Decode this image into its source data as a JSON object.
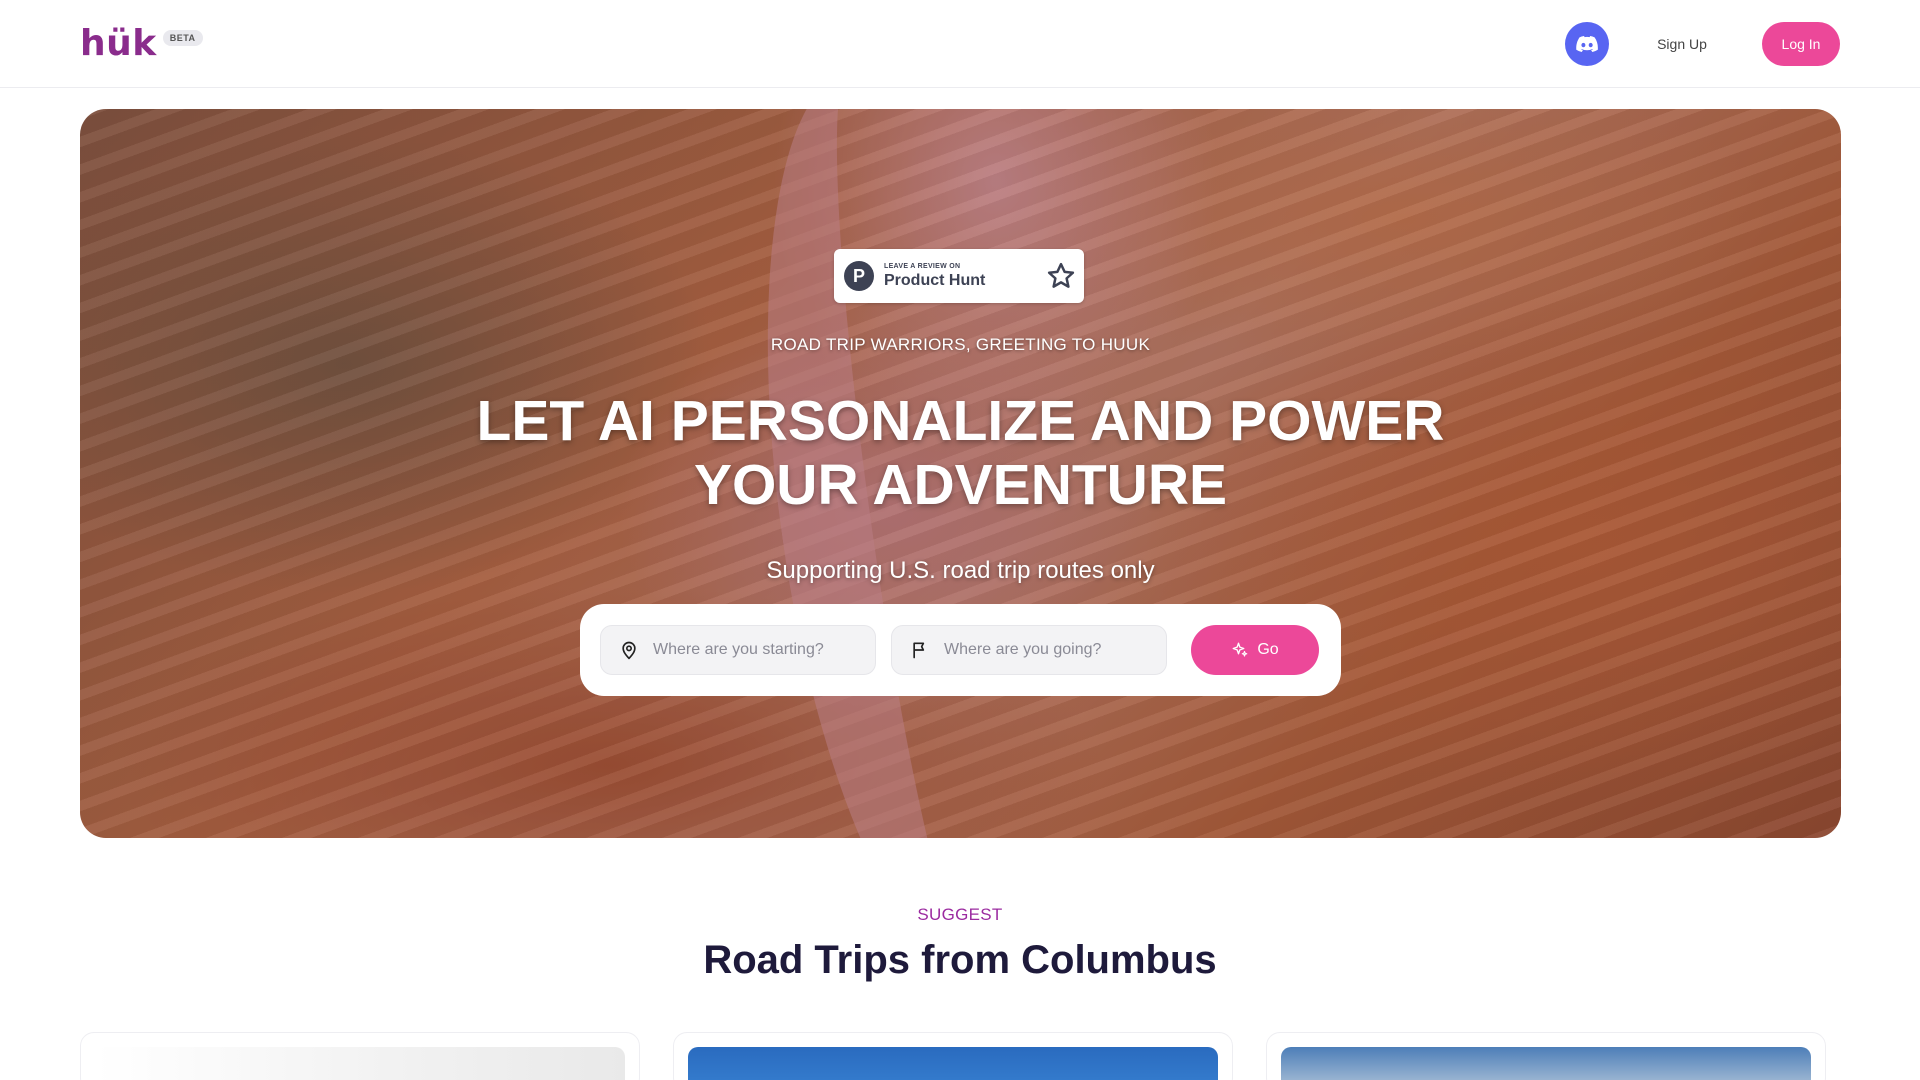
{
  "header": {
    "logo_text": "hük",
    "beta_label": "BETA",
    "signup_label": "Sign Up",
    "login_label": "Log In"
  },
  "hero": {
    "product_hunt": {
      "small_text": "LEAVE A REVIEW ON",
      "big_text": "Product Hunt",
      "logo_letter": "P"
    },
    "greeting": "ROAD TRIP WARRIORS, GREETING TO HUUK",
    "headline_line1": "LET AI PERSONALIZE AND POWER",
    "headline_line2": "YOUR ADVENTURE",
    "subline": "Supporting U.S. road trip routes only",
    "search": {
      "start_placeholder": "Where are you starting?",
      "end_placeholder": "Where are you going?",
      "go_label": "Go"
    }
  },
  "suggest": {
    "label": "SUGGEST",
    "title": "Road Trips from Columbus"
  },
  "colors": {
    "brand_pink": "#ec4899",
    "discord_blue": "#5865f2",
    "brand_purple": "#8a2c8c"
  },
  "icons": {
    "discord": "discord-icon",
    "product_hunt_star": "star-icon",
    "start_field": "map-pin-icon",
    "end_field": "flag-icon",
    "go_button": "sparkle-icon"
  }
}
